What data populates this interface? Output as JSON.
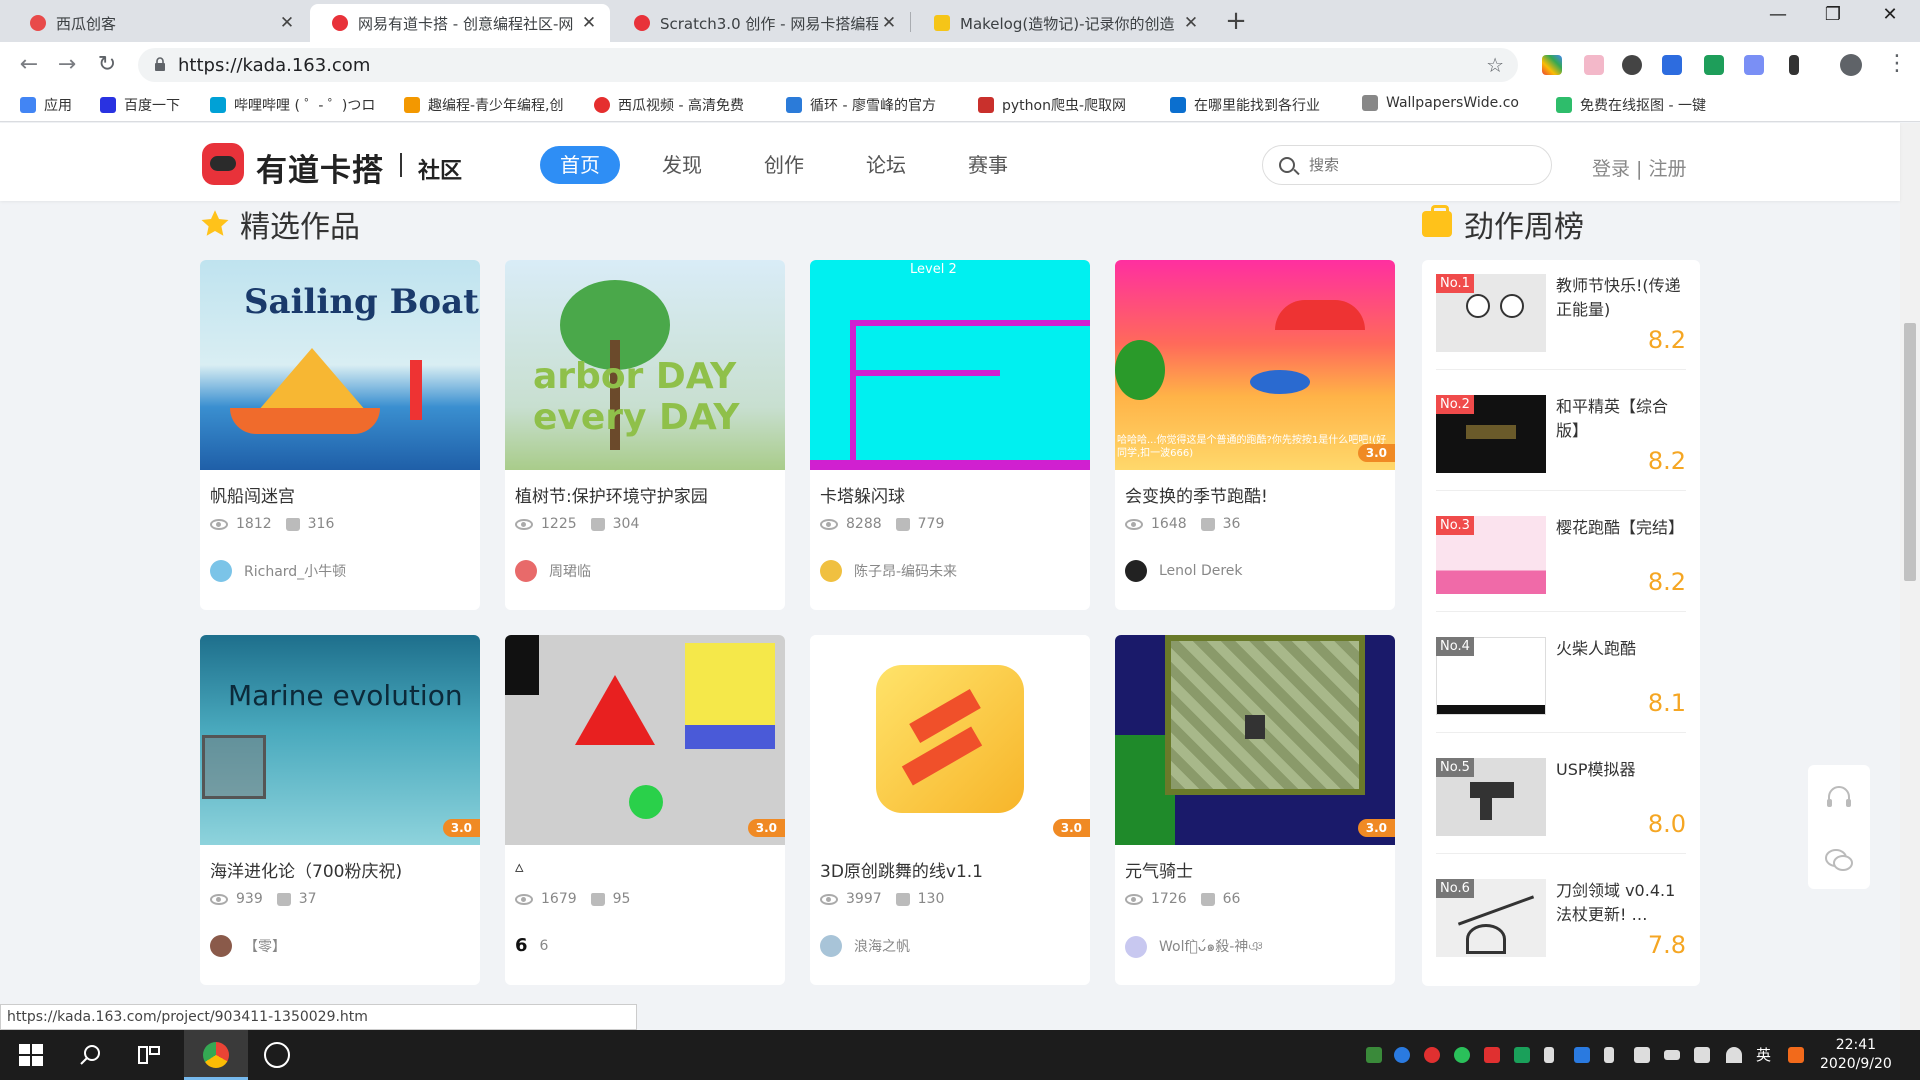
{
  "browser": {
    "tabs": [
      {
        "title": "西瓜创客",
        "color": "#e84a4a"
      },
      {
        "title": "网易有道卡搭 - 创意编程社区-网",
        "color": "#e8323a"
      },
      {
        "title": "Scratch3.0 创作 - 网易卡搭编程",
        "color": "#e8323a"
      },
      {
        "title": "Makelog(造物记)-记录你的创造",
        "color": "#f5c518"
      }
    ],
    "url": "https://kada.163.com",
    "bookmarks": [
      {
        "label": "应用",
        "color": "#4285f4"
      },
      {
        "label": "百度一下",
        "color": "#2932e1"
      },
      {
        "label": "哔哩哔哩 ( ゜- ゜)つロ",
        "color": "#00a1d6"
      },
      {
        "label": "趣编程-青少年编程,创",
        "color": "#f39800"
      },
      {
        "label": "西瓜视频 - 高清免费",
        "color": "#e52e2e"
      },
      {
        "label": "循环 - 廖雪峰的官方",
        "color": "#2b7bd9"
      },
      {
        "label": "python爬虫-爬取网",
        "color": "#c9302c"
      },
      {
        "label": "在哪里能找到各行业",
        "color": "#0b6fcf"
      },
      {
        "label": "WallpapersWide.co",
        "color": "#888888"
      },
      {
        "label": "免费在线抠图 - 一键",
        "color": "#2ebd6b"
      }
    ],
    "status_url": "https://kada.163.com/project/903411-1350029.htm"
  },
  "site": {
    "logo_text": "有道卡搭",
    "logo_sub": "社区",
    "nav": [
      "首页",
      "发现",
      "创作",
      "论坛",
      "赛事"
    ],
    "search_placeholder": "搜索",
    "login": "登录 | 注册"
  },
  "featured": {
    "title": "精选作品",
    "cards": [
      {
        "title": "帆船闯迷宫",
        "views": "1812",
        "likes": "316",
        "author": "Richard_小牛顿",
        "thumb_text": "Sailing Boat",
        "badge": ""
      },
      {
        "title": "植树节:保护环境守护家园",
        "views": "1225",
        "likes": "304",
        "author": "周珺临",
        "thumb_text": "arbor DAY  every DAY",
        "badge": ""
      },
      {
        "title": "卡塔躲闪球",
        "views": "8288",
        "likes": "779",
        "author": "陈子昂-编码未来",
        "thumb_text": "Level 2",
        "badge": ""
      },
      {
        "title": "会变换的季节跑酷!",
        "views": "1648",
        "likes": "36",
        "author": "Lenol Derek",
        "thumb_text": "哈哈哈...你觉得这是个普通的跑酷?你先按按1是什么吧吧!(好同学,扣一波666)",
        "badge": "3.0"
      },
      {
        "title": "海洋进化论（700粉庆祝)",
        "views": "939",
        "likes": "37",
        "author": "【零】",
        "thumb_text": "Marine evolution",
        "badge": "3.0"
      },
      {
        "title": "▵",
        "views": "1679",
        "likes": "95",
        "author": "6",
        "author_prefix": "6",
        "thumb_text": "",
        "badge": "3.0"
      },
      {
        "title": "3D原创跳舞的线v1.1",
        "views": "3997",
        "likes": "130",
        "author": "浪海之帆",
        "thumb_text": "",
        "badge": "3.0"
      },
      {
        "title": "元气骑士",
        "views": "1726",
        "likes": "66",
        "author": "Wolf๑̀ᴗ́๑殺-神ঞ",
        "thumb_text": "",
        "badge": "3.0"
      }
    ]
  },
  "ranking": {
    "title": "劲作周榜",
    "items": [
      {
        "no": "No.1",
        "name": "教师节快乐!(传递正能量)",
        "score": "8.2"
      },
      {
        "no": "No.2",
        "name": "和平精英【综合版】",
        "score": "8.2"
      },
      {
        "no": "No.3",
        "name": "樱花跑酷【完结】",
        "score": "8.2"
      },
      {
        "no": "No.4",
        "name": "火柴人跑酷",
        "score": "8.1"
      },
      {
        "no": "No.5",
        "name": "USP模拟器",
        "score": "8.0"
      },
      {
        "no": "No.6",
        "name": "刀剑领域 v0.4.1法杖更新! …",
        "score": "7.8"
      }
    ]
  },
  "taskbar": {
    "time": "22:41",
    "date": "2020/9/20",
    "ime": "英"
  }
}
